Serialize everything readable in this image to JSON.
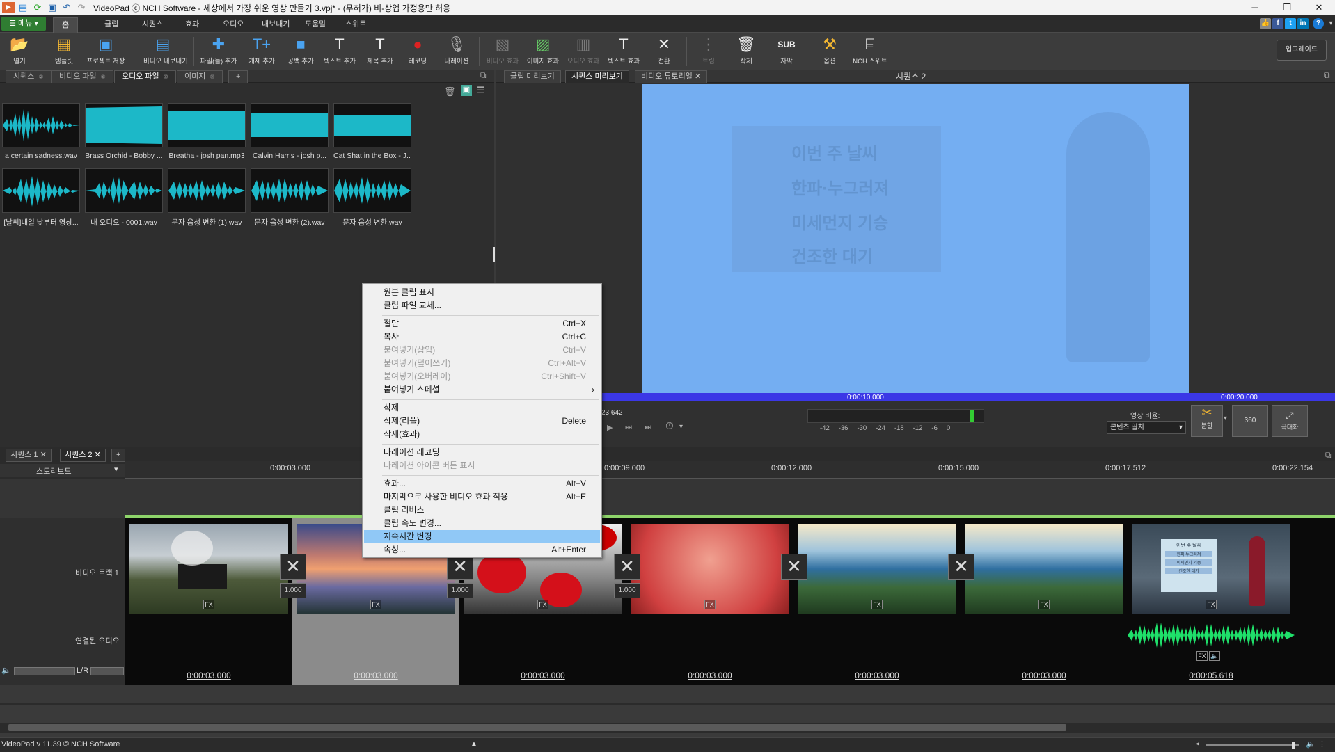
{
  "title_bar": {
    "title": "VideoPad ⓒ NCH Software - 세상에서 가장 쉬운 영상 만들기 3.vpj* - (무허가) 비-상업 가정용만 허용"
  },
  "menu_bar": {
    "menu_button": "메뉴",
    "tabs": [
      "홈",
      "클립",
      "시퀀스",
      "효과",
      "오디오",
      "내보내기",
      "도움말",
      "스위트"
    ]
  },
  "toolbar": {
    "items": [
      {
        "label": "열기",
        "icon": "open-folder-icon"
      },
      {
        "label": "템플릿",
        "icon": "template-icon"
      },
      {
        "label": "프로젝트 저장",
        "icon": "save-icon"
      },
      {
        "label": "비디오 내보내기",
        "icon": "export-video-icon"
      },
      {
        "label": "파일(들) 추가",
        "icon": "add-files-icon"
      },
      {
        "label": "개체 추가",
        "icon": "add-object-icon"
      },
      {
        "label": "공백 추가",
        "icon": "add-blank-icon"
      },
      {
        "label": "텍스트 추가",
        "icon": "add-text-icon"
      },
      {
        "label": "제목 추가",
        "icon": "add-title-icon"
      },
      {
        "label": "레코딩",
        "icon": "record-icon"
      },
      {
        "label": "나레이션",
        "icon": "narration-icon"
      },
      {
        "label": "비디오 효과",
        "icon": "video-effects-icon"
      },
      {
        "label": "이미지 효과",
        "icon": "image-effects-icon"
      },
      {
        "label": "오디오 효과",
        "icon": "audio-effects-icon"
      },
      {
        "label": "텍스트 효과",
        "icon": "text-effects-icon"
      },
      {
        "label": "전환",
        "icon": "transition-icon"
      },
      {
        "label": "트림",
        "icon": "trim-icon"
      },
      {
        "label": "삭제",
        "icon": "trash-icon"
      },
      {
        "label": "자막",
        "icon": "subtitle-icon"
      },
      {
        "label": "옵션",
        "icon": "options-icon"
      },
      {
        "label": "NCH 스위트",
        "icon": "nch-suite-icon"
      }
    ],
    "upgrade": "업그레이드"
  },
  "bin": {
    "tabs": [
      "시퀀스",
      "비디오 파일",
      "오디오 파일",
      "이미지"
    ],
    "active_tab": "오디오 파일",
    "files": [
      "a certain sadness.wav",
      "Brass Orchid - Bobby ...",
      "Breatha - josh pan.mp3",
      "Calvin Harris - josh p...",
      "Cat Shat in the Box - J...",
      "[날씨]내일 낮부터 영상...",
      "내 오디오 - 0001.wav",
      "문자 음성 변환 (1).wav",
      "문자 음성 변환 (2).wav",
      "문자 음성 변환.wav"
    ]
  },
  "preview": {
    "tabs": [
      "클립 미리보기",
      "시퀀스 미리보기",
      "비디오 튜토리얼"
    ],
    "active_tab": "시퀀스 미리보기",
    "sequence_title": "시퀀스 2",
    "time_marks": [
      "0:00:10.000",
      "0:00:20.000"
    ],
    "current_time": "23.642",
    "meter_labels": [
      "-42",
      "-36",
      "-30",
      "-24",
      "-18",
      "-12",
      "-6",
      "0"
    ],
    "aspect_label": "영상 비율:",
    "aspect_value": "콘텐츠 일치",
    "split_label": "분할",
    "vr_label": "360",
    "fullscreen_label": "극대화",
    "ghost_text": [
      "이번 주 날씨",
      "한파·누그러져",
      "미세먼지 기승",
      "건조한 대기"
    ]
  },
  "timeline": {
    "sequence_tabs": [
      "시퀀스 1",
      "시퀀스 2"
    ],
    "mode": "스토리보드",
    "ruler": [
      "0:00:03.000",
      "0:00:09.000",
      "0:00:12.000",
      "0:00:15.000",
      "0:00:17.512",
      "0:00:22.154"
    ],
    "video_track_label": "비디오 트랙 1",
    "audio_track_label": "연결된 오디오",
    "lr_label": "L/R",
    "transition_values": [
      "1.000",
      "1.000",
      "1.000"
    ],
    "clip_durations": [
      "0:00:03.000",
      "0:00:03.000",
      "0:00:03.000",
      "0:00:03.000",
      "0:00:03.000",
      "0:00:03.000",
      "0:00:05.618"
    ],
    "fx_label": "FX",
    "weather_card_lines": [
      "이번 주 날씨",
      "한파 누그러져",
      "미세먼지 기승",
      "건조한 대기"
    ]
  },
  "context_menu": {
    "items": [
      {
        "label": "원본 클립 표시",
        "shortcut": "",
        "enabled": true
      },
      {
        "label": "클립 파일 교체...",
        "shortcut": "",
        "enabled": true
      },
      {
        "label": "절단",
        "shortcut": "Ctrl+X",
        "enabled": true
      },
      {
        "label": "복사",
        "shortcut": "Ctrl+C",
        "enabled": true
      },
      {
        "label": "붙여넣기(삽입)",
        "shortcut": "Ctrl+V",
        "enabled": false
      },
      {
        "label": "붙여넣기(덮어쓰기)",
        "shortcut": "Ctrl+Alt+V",
        "enabled": false
      },
      {
        "label": "붙여넣기(오버레이)",
        "shortcut": "Ctrl+Shift+V",
        "enabled": false
      },
      {
        "label": "붙여넣기 스페셜",
        "shortcut": "›",
        "enabled": true
      },
      {
        "label": "삭제",
        "shortcut": "",
        "enabled": true
      },
      {
        "label": "삭제(리플)",
        "shortcut": "Delete",
        "enabled": true
      },
      {
        "label": "삭제(효과)",
        "shortcut": "",
        "enabled": true
      },
      {
        "label": "나레이션 레코딩",
        "shortcut": "",
        "enabled": true
      },
      {
        "label": "나레이션 아이콘 버튼 표시",
        "shortcut": "",
        "enabled": false
      },
      {
        "label": "효과...",
        "shortcut": "Alt+V",
        "enabled": true
      },
      {
        "label": "마지막으로 사용한 비디오 효과 적용",
        "shortcut": "Alt+E",
        "enabled": true
      },
      {
        "label": "클립 리버스",
        "shortcut": "",
        "enabled": true
      },
      {
        "label": "클립 속도 변경...",
        "shortcut": "",
        "enabled": true
      },
      {
        "label": "지속시간 변경",
        "shortcut": "",
        "enabled": true,
        "highlighted": true
      },
      {
        "label": "속성...",
        "shortcut": "Alt+Enter",
        "enabled": true
      }
    ]
  },
  "status_bar": {
    "text": "VideoPad v 11.39 © NCH Software"
  }
}
